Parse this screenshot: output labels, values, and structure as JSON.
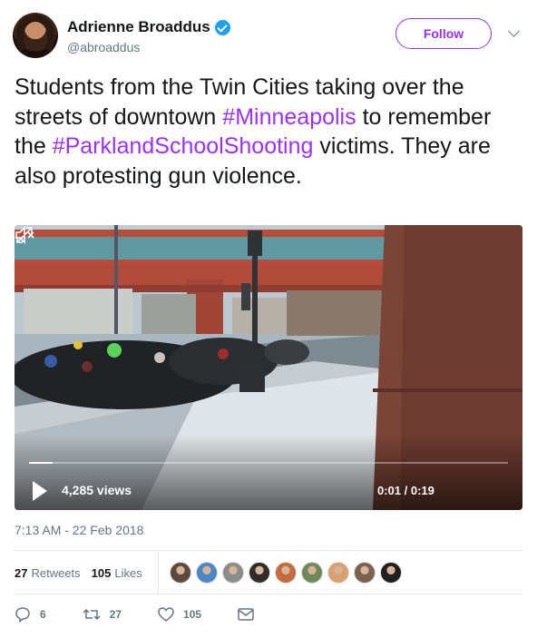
{
  "user": {
    "name": "Adrienne Broaddus",
    "handle": "@abroaddus",
    "verified": true
  },
  "follow_label": "Follow",
  "tweet": {
    "segments": [
      {
        "text": "Students from the Twin Cities taking over the streets of downtown ",
        "type": "text"
      },
      {
        "text": "#Minneapolis",
        "type": "hashtag"
      },
      {
        "text": " to remember the ",
        "type": "text"
      },
      {
        "text": "#ParklandSchoolShooting",
        "type": "hashtag"
      },
      {
        "text": " victims. They are also protesting gun violence.",
        "type": "text"
      }
    ]
  },
  "video": {
    "views": "4,285 views",
    "time": "0:01 / 0:19",
    "progress": 0.05
  },
  "timestamp": "7:13 AM - 22 Feb 2018",
  "stats": {
    "retweets_count": "27",
    "retweets_label": "Retweets",
    "likes_count": "105",
    "likes_label": "Likes"
  },
  "likers": [
    "#5a4a3e",
    "#4b87c4",
    "#8c8c8c",
    "#2d2d2d",
    "#c46a3d",
    "#6f8a5a",
    "#d9a070",
    "#7a6250",
    "#1f1f1f"
  ],
  "actions": {
    "reply_count": "6",
    "retweet_count": "27",
    "like_count": "105"
  },
  "colors": {
    "accent": "#9b30ff",
    "verified": "#1da1f2",
    "muted": "#657786"
  }
}
